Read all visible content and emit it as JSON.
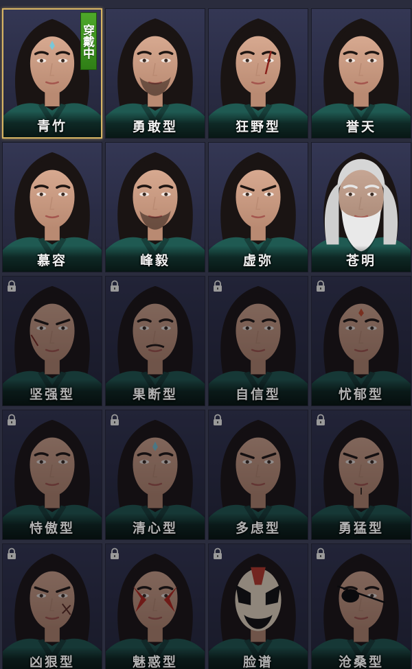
{
  "equipped_badge": "穿戴中",
  "colors": {
    "selected_border": "#d8b564",
    "badge_green": "#3e9a20",
    "robe_teal": "#1f5a52"
  },
  "cards": [
    {
      "label": "青竹",
      "locked": false,
      "selected": true,
      "variant": "scholar-forehead-mark",
      "icon": "face-portrait"
    },
    {
      "label": "勇敢型",
      "locked": false,
      "selected": false,
      "variant": "stubble-beard",
      "icon": "face-portrait"
    },
    {
      "label": "狂野型",
      "locked": false,
      "selected": false,
      "variant": "eye-scar",
      "icon": "face-portrait"
    },
    {
      "label": "誉天",
      "locked": false,
      "selected": false,
      "variant": "young-clean",
      "icon": "face-portrait"
    },
    {
      "label": "慕容",
      "locked": false,
      "selected": false,
      "variant": "young-clean",
      "icon": "face-portrait"
    },
    {
      "label": "峰毅",
      "locked": false,
      "selected": false,
      "variant": "goatee",
      "icon": "face-portrait"
    },
    {
      "label": "虚弥",
      "locked": false,
      "selected": false,
      "variant": "stern",
      "icon": "face-portrait"
    },
    {
      "label": "苍明",
      "locked": false,
      "selected": false,
      "variant": "old-white-beard",
      "icon": "face-portrait"
    },
    {
      "label": "坚强型",
      "locked": true,
      "selected": false,
      "variant": "cheek-scar",
      "icon": "face-portrait"
    },
    {
      "label": "果断型",
      "locked": true,
      "selected": false,
      "variant": "mustache",
      "icon": "face-portrait"
    },
    {
      "label": "自信型",
      "locked": true,
      "selected": false,
      "variant": "young-clean",
      "icon": "face-portrait"
    },
    {
      "label": "忧郁型",
      "locked": true,
      "selected": false,
      "variant": "forehead-gem",
      "icon": "face-portrait"
    },
    {
      "label": "恃傲型",
      "locked": true,
      "selected": false,
      "variant": "young-clean",
      "icon": "face-portrait"
    },
    {
      "label": "清心型",
      "locked": true,
      "selected": false,
      "variant": "blue-forehead-gem",
      "icon": "face-portrait"
    },
    {
      "label": "多虑型",
      "locked": true,
      "selected": false,
      "variant": "stern",
      "icon": "face-portrait"
    },
    {
      "label": "勇猛型",
      "locked": true,
      "selected": false,
      "variant": "chin-mark",
      "icon": "face-portrait"
    },
    {
      "label": "凶狠型",
      "locked": true,
      "selected": false,
      "variant": "cross-scar",
      "icon": "face-portrait"
    },
    {
      "label": "魅惑型",
      "locked": true,
      "selected": false,
      "variant": "red-face-paint",
      "icon": "face-portrait"
    },
    {
      "label": "脸谱",
      "locked": true,
      "selected": false,
      "variant": "opera-mask",
      "icon": "face-portrait"
    },
    {
      "label": "沧桑型",
      "locked": true,
      "selected": false,
      "variant": "eyepatch",
      "icon": "face-portrait"
    }
  ]
}
